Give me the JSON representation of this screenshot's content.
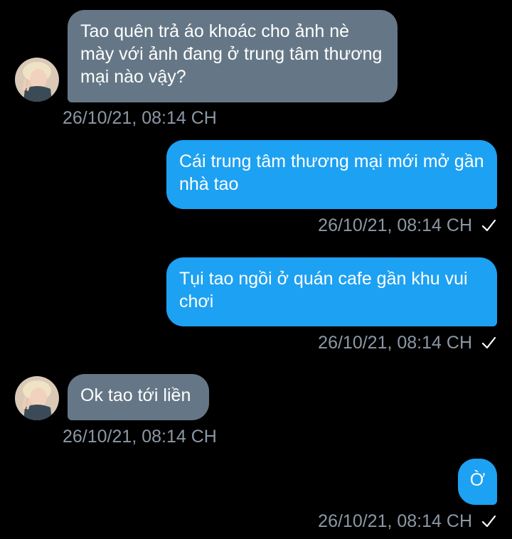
{
  "colors": {
    "background": "#000000",
    "incoming_bubble": "#657786",
    "outgoing_bubble": "#1da1f2",
    "timestamp": "#8b98a5"
  },
  "messages": [
    {
      "direction": "incoming",
      "text": "Tao quên trả áo khoác cho ảnh nè mày với ảnh đang ở trung tâm thương mại nào vậy?",
      "timestamp": "26/10/21, 08:14 CH",
      "avatar": "user-avatar"
    },
    {
      "direction": "outgoing",
      "text": "Cái trung tâm thương mại mới mở gần nhà tao",
      "timestamp": "26/10/21, 08:14 CH",
      "status_icon": "check-icon"
    },
    {
      "direction": "outgoing",
      "text": "Tụi tao ngồi ở quán cafe gần khu vui chơi",
      "timestamp": "26/10/21, 08:14 CH",
      "status_icon": "check-icon"
    },
    {
      "direction": "incoming",
      "text": "Ok tao tới liền",
      "timestamp": "26/10/21, 08:14 CH",
      "avatar": "user-avatar"
    },
    {
      "direction": "outgoing",
      "text": "Ờ",
      "timestamp": "26/10/21, 08:14 CH",
      "status_icon": "check-icon"
    }
  ]
}
